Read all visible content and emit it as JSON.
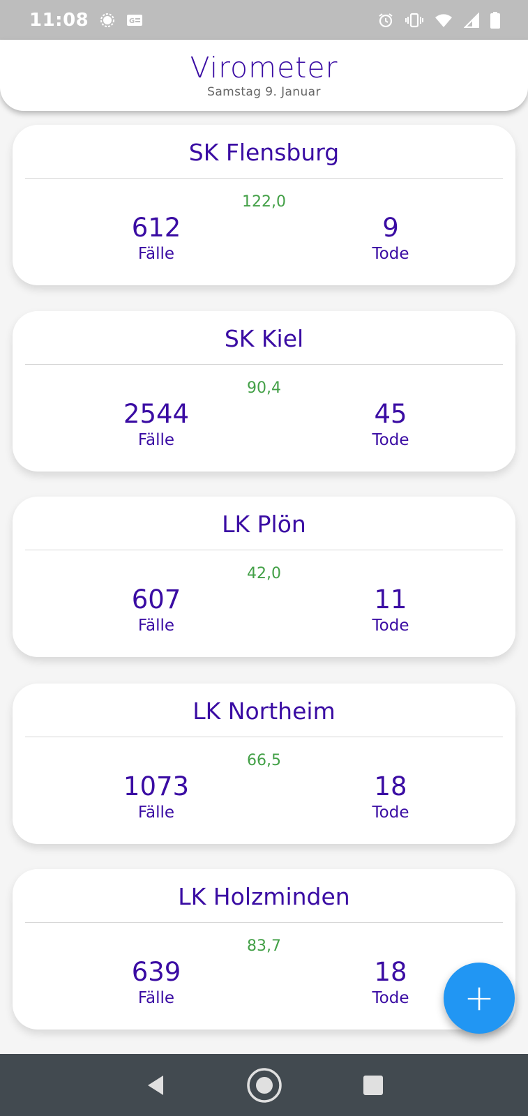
{
  "status_bar": {
    "time": "11:08",
    "left_icons": [
      "signal-messenger-icon",
      "news-icon"
    ],
    "right_icons": [
      "alarm-icon",
      "vibrate-icon",
      "wifi-icon",
      "cell-signal-icon",
      "battery-icon"
    ]
  },
  "header": {
    "title": "Virometer",
    "date": "Samstag 9. Januar"
  },
  "cards": [
    {
      "name": "SK Flensburg",
      "rate": "122,0",
      "cases": "612",
      "cases_label": "Fälle",
      "deaths": "9",
      "deaths_label": "Tode"
    },
    {
      "name": "SK Kiel",
      "rate": "90,4",
      "cases": "2544",
      "cases_label": "Fälle",
      "deaths": "45",
      "deaths_label": "Tode"
    },
    {
      "name": "LK Plön",
      "rate": "42,0",
      "cases": "607",
      "cases_label": "Fälle",
      "deaths": "11",
      "deaths_label": "Tode"
    },
    {
      "name": "LK Northeim",
      "rate": "66,5",
      "cases": "1073",
      "cases_label": "Fälle",
      "deaths": "18",
      "deaths_label": "Tode"
    },
    {
      "name": "LK Holzminden",
      "rate": "83,7",
      "cases": "639",
      "cases_label": "Fälle",
      "deaths": "18",
      "deaths_label": "Tode"
    }
  ],
  "fab": {
    "icon": "plus-icon",
    "label": "+",
    "color": "#2196f3"
  },
  "colors": {
    "accent": "#3a0ca3",
    "rate": "#43a047"
  },
  "nav_bar": {
    "buttons": [
      "back-icon",
      "home-icon",
      "recents-icon"
    ]
  }
}
